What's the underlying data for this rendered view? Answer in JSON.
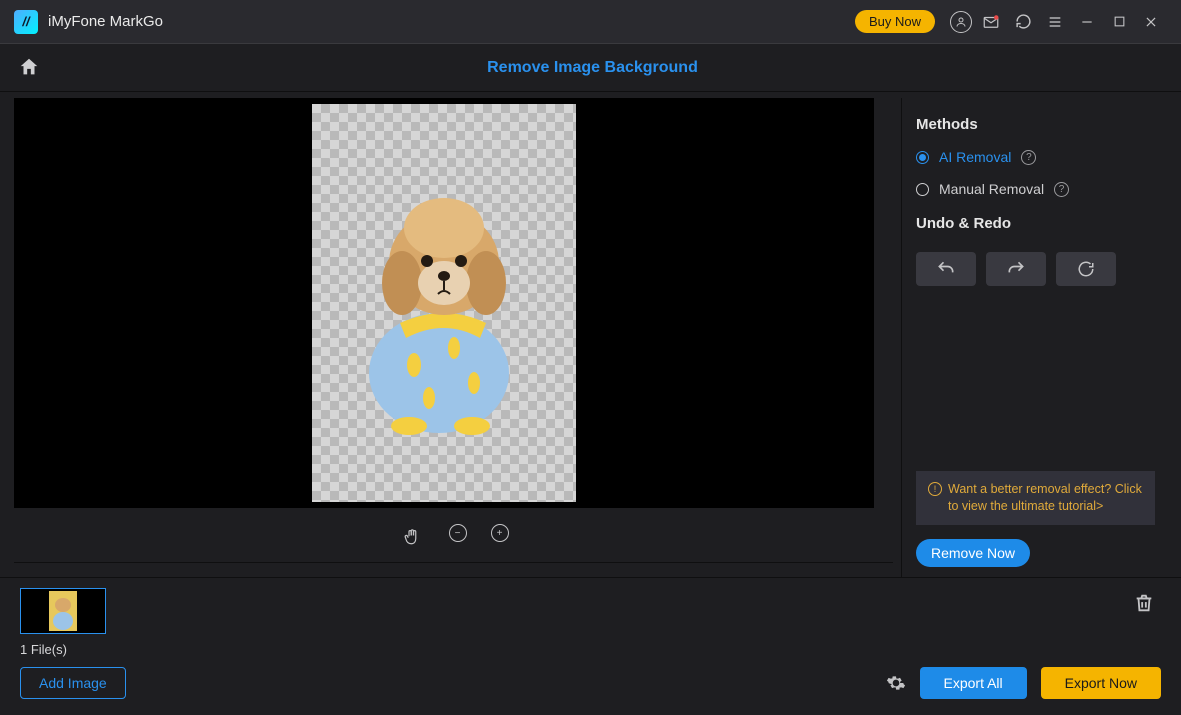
{
  "titlebar": {
    "app_name": "iMyFone MarkGo",
    "buy_now": "Buy Now"
  },
  "header": {
    "page_title": "Remove Image Background"
  },
  "sidepanel": {
    "methods_title": "Methods",
    "ai_removal": "AI Removal",
    "manual_removal": "Manual Removal",
    "undo_redo_title": "Undo & Redo",
    "tip_text": "Want a better removal effect? Click to view the ultimate tutorial>",
    "remove_now": "Remove Now"
  },
  "bottom": {
    "file_count": "1 File(s)",
    "add_image": "Add Image",
    "export_all": "Export All",
    "export_now": "Export Now"
  }
}
